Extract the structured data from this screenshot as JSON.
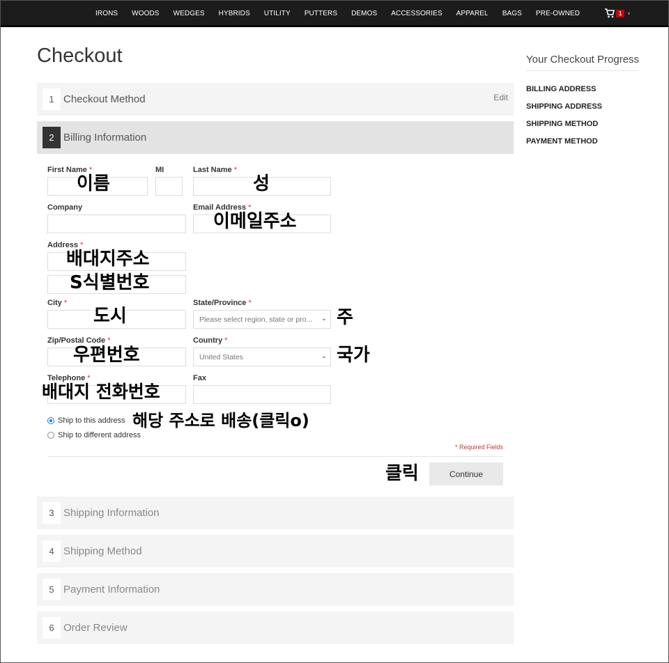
{
  "nav": {
    "items": [
      "IRONS",
      "WOODS",
      "WEDGES",
      "HYBRIDS",
      "UTILITY",
      "PUTTERS",
      "DEMOS",
      "ACCESSORIES",
      "APPAREL",
      "BAGS",
      "PRE-OWNED"
    ],
    "cart_count": "1"
  },
  "page": {
    "title": "Checkout"
  },
  "steps": [
    {
      "num": "1",
      "title": "Checkout Method",
      "edit": "Edit"
    },
    {
      "num": "2",
      "title": "Billing Information"
    },
    {
      "num": "3",
      "title": "Shipping Information"
    },
    {
      "num": "4",
      "title": "Shipping Method"
    },
    {
      "num": "5",
      "title": "Payment Information"
    },
    {
      "num": "6",
      "title": "Order Review"
    }
  ],
  "form": {
    "first_name_label": "First Name",
    "mi_label": "MI",
    "last_name_label": "Last Name",
    "company_label": "Company",
    "email_label": "Email Address",
    "address_label": "Address",
    "city_label": "City",
    "state_label": "State/Province",
    "state_placeholder": "Please select region, state or pro...",
    "zip_label": "Zip/Postal Code",
    "country_label": "Country",
    "country_value": "United States",
    "telephone_label": "Telephone",
    "fax_label": "Fax",
    "required_mark": "*",
    "ship_same": "Ship to this address",
    "ship_diff": "Ship to different address",
    "required_note": "* Required Fields",
    "continue": "Continue"
  },
  "annotations": {
    "first_name": "이름",
    "last_name": "성",
    "email": "이메일주소",
    "address1": "배대지주소",
    "address2": "S식별번호",
    "city": "도시",
    "state": "주",
    "zip": "우편번호",
    "country": "국가",
    "telephone": "배대지 전화번호",
    "ship_option": "해당 주소로 배송(클릭o)",
    "continue": "클릭"
  },
  "sidebar": {
    "title": "Your Checkout Progress",
    "items": [
      "BILLING ADDRESS",
      "SHIPPING ADDRESS",
      "SHIPPING METHOD",
      "PAYMENT METHOD"
    ]
  },
  "colors": {
    "nav_bg": "#1c1c1c",
    "badge": "#cc0000",
    "required": "#cc3333",
    "active_step": "#333333"
  }
}
